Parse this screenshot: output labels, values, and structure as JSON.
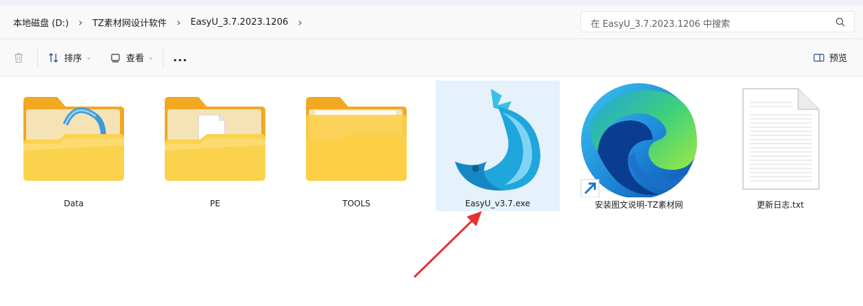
{
  "breadcrumb": {
    "items": [
      "本地磁盘 (D:)",
      "TZ素材网设计软件",
      "EasyU_3.7.2023.1206"
    ]
  },
  "search": {
    "placeholder": "在 EasyU_3.7.2023.1206 中搜索"
  },
  "toolbar": {
    "sort_label": "排序",
    "view_label": "查看",
    "more_label": "...",
    "preview_label": "预览",
    "icons": [
      "trash-icon",
      "sort-icon",
      "view-icon",
      "more-icon",
      "preview-pane-icon"
    ]
  },
  "files": [
    {
      "name": "Data",
      "icon": "folder-icon"
    },
    {
      "name": "PE",
      "icon": "folder-icon"
    },
    {
      "name": "TOOLS",
      "icon": "folder-icon"
    },
    {
      "name": "EasyU_v3.7.exe",
      "icon": "easyu-app-icon",
      "selected": true
    },
    {
      "name": "安装图文说明-TZ素材网",
      "icon": "edge-shortcut-icon"
    },
    {
      "name": "更新日志.txt",
      "icon": "text-file-icon"
    }
  ],
  "colors": {
    "folder": "#f8c746",
    "selection": "#e5f1fb",
    "annotation_arrow": "#e8312f",
    "shortcut_arrow": "#1a73c9"
  }
}
